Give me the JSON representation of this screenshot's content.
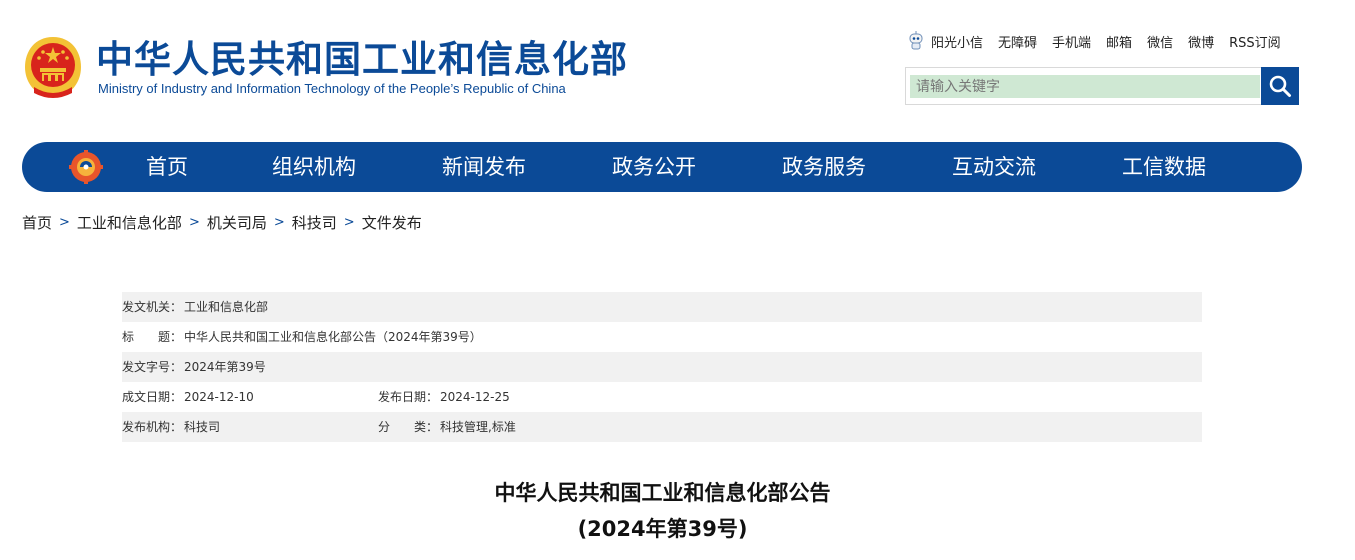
{
  "header": {
    "title": "中华人民共和国工业和信息化部",
    "subtitle": "Ministry of Industry and Information Technology of the People’s Republic of China",
    "top_links": [
      "阳光小信",
      "无障碍",
      "手机端",
      "邮箱",
      "微信",
      "微博",
      "RSS订阅"
    ],
    "search": {
      "placeholder": "请输入关键字",
      "value": ""
    }
  },
  "nav": {
    "items": [
      "首页",
      "组织机构",
      "新闻发布",
      "政务公开",
      "政务服务",
      "互动交流",
      "工信数据"
    ]
  },
  "breadcrumb": [
    "首页",
    "工业和信息化部",
    "机关司局",
    "科技司",
    "文件发布"
  ],
  "doc_info": {
    "issuer_label": "发文机关：",
    "issuer": "工业和信息化部",
    "title_label": "标　　题：",
    "title": "中华人民共和国工业和信息化部公告（2024年第39号）",
    "docno_label": "发文字号：",
    "docno": "2024年第39号",
    "created_label": "成文日期：",
    "created": "2024-12-10",
    "published_label": "发布日期：",
    "published": "2024-12-25",
    "org_label": "发布机构：",
    "org": "科技司",
    "category_label": "分　　类：",
    "category": "科技管理,标准"
  },
  "doc_title": {
    "line1": "中华人民共和国工业和信息化部公告",
    "line2": "(2024年第39号)"
  },
  "colors": {
    "brand": "#0b4a97",
    "row_shade": "#f1f1f1",
    "search_fill": "#cfe8d3",
    "emblem_red": "#d8241c",
    "emblem_gold": "#f3c236"
  }
}
